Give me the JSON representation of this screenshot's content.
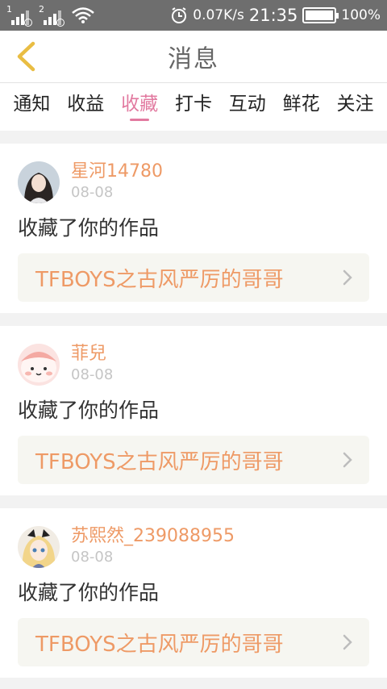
{
  "status_bar": {
    "sim1": "1",
    "sim2": "2",
    "net_speed": "0.07K/s",
    "time": "21:35",
    "battery": "100%",
    "battery_level": 1.0
  },
  "header": {
    "title": "消息"
  },
  "tabs": [
    {
      "label": "通知",
      "active": false
    },
    {
      "label": "收益",
      "active": false
    },
    {
      "label": "收藏",
      "active": true
    },
    {
      "label": "打卡",
      "active": false
    },
    {
      "label": "互动",
      "active": false
    },
    {
      "label": "鲜花",
      "active": false
    },
    {
      "label": "关注",
      "active": false
    }
  ],
  "items": [
    {
      "user": "星河14780",
      "date": "08-08",
      "action": "收藏了你的作品",
      "work": "TFBOYS之古风严厉的哥哥"
    },
    {
      "user": "菲兒",
      "date": "08-08",
      "action": "收藏了你的作品",
      "work": "TFBOYS之古风严厉的哥哥"
    },
    {
      "user": "苏熙然_239088955",
      "date": "08-08",
      "action": "收藏了你的作品",
      "work": "TFBOYS之古风严厉的哥哥"
    }
  ],
  "colors": {
    "accent_pink": "#e27aa0",
    "accent_orange": "#ee9a66",
    "back_arrow": "#e9bd43"
  }
}
